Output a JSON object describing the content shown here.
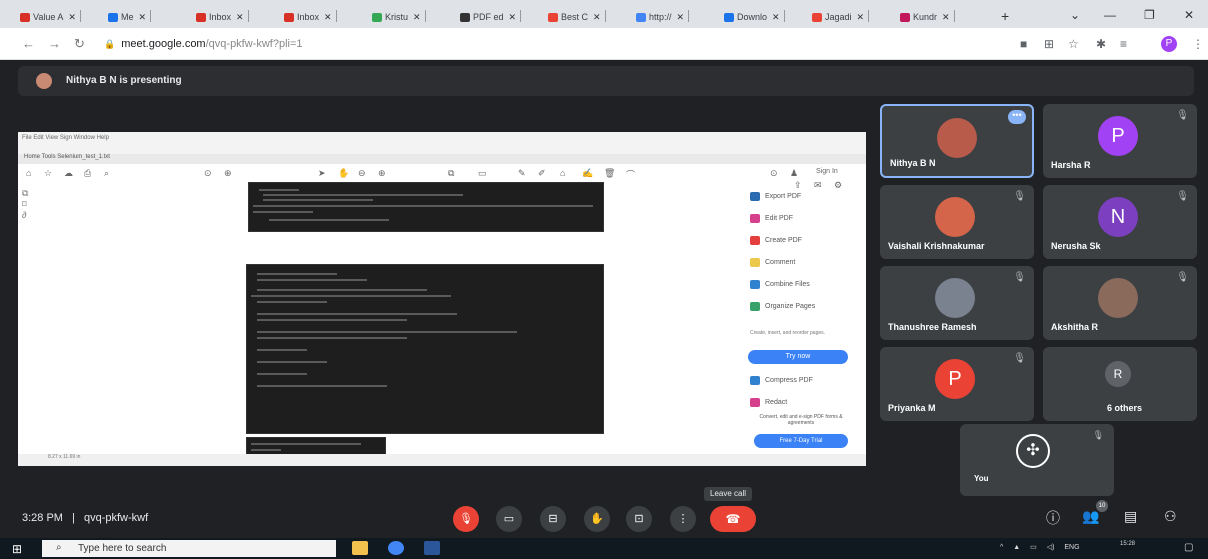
{
  "browser": {
    "tabs": [
      {
        "label": "Value A",
        "color": "#d93025"
      },
      {
        "label": "Me",
        "color": "#1a73e8"
      },
      {
        "label": "Inbox",
        "color": "#d93025"
      },
      {
        "label": "Inbox",
        "color": "#d93025"
      },
      {
        "label": "Kristu",
        "color": "#34a853"
      },
      {
        "label": "PDF ed",
        "color": "#333333"
      },
      {
        "label": "Best C",
        "color": "#ea4335"
      },
      {
        "label": "http://",
        "color": "#4285f4"
      },
      {
        "label": "Downlo",
        "color": "#1a73e8"
      },
      {
        "label": "Jagadi",
        "color": "#ea4335"
      },
      {
        "label": "Kundr",
        "color": "#c2185b"
      }
    ],
    "new_tab": "+",
    "url_host": "meet.google.com",
    "url_path": "/qvq-pkfw-kwf?pli=1",
    "profile_initial": "P"
  },
  "meet": {
    "presenting_text": "Nithya B N is presenting",
    "shared_screen": {
      "menu_text": "File  Edit  View  Sign  Window  Help",
      "tabs_text": "Home   Tools   Selenium_test_1.txt",
      "sign_in": "Sign In",
      "tools": [
        {
          "label": "Export PDF",
          "color": "#2b6cb0"
        },
        {
          "label": "Edit PDF",
          "color": "#d53f8c"
        },
        {
          "label": "Create PDF",
          "color": "#e53e3e"
        },
        {
          "label": "Comment",
          "color": "#ecc94b"
        },
        {
          "label": "Combine Files",
          "color": "#3182ce"
        },
        {
          "label": "Organize Pages",
          "color": "#38a169"
        }
      ],
      "promo_text": "Create, insert, and reorder pages.",
      "try_now": "Try now",
      "tools2": [
        {
          "label": "Compress PDF",
          "color": "#3182ce"
        },
        {
          "label": "Redact",
          "color": "#d53f8c"
        }
      ],
      "convert_text": "Convert, edit and e-sign PDF forms & agreements",
      "free_trial": "Free 7-Day Trial",
      "status_text": "8.27 x 11.69 in"
    },
    "participants": [
      {
        "name": "Nithya B N",
        "initial": "",
        "avatar_color": "#b85b4a",
        "active": true
      },
      {
        "name": "Harsha R",
        "initial": "P",
        "avatar_color": "#a142f4",
        "active": false
      },
      {
        "name": "Vaishali Krishnakumar",
        "initial": "",
        "avatar_color": "#d4644a",
        "active": false
      },
      {
        "name": "Nerusha Sk",
        "initial": "N",
        "avatar_color": "#7b3fbf",
        "active": false
      },
      {
        "name": "Thanushree Ramesh",
        "initial": "",
        "avatar_color": "#7a8290",
        "active": false
      },
      {
        "name": "Akshitha R",
        "initial": "",
        "avatar_color": "#8a6a5a",
        "active": false
      },
      {
        "name": "Priyanka M",
        "initial": "P",
        "avatar_color": "#ea4335",
        "active": false
      },
      {
        "name": "6 others",
        "initial": "R",
        "avatar_color": "#5f6368",
        "active": false
      }
    ],
    "self_label": "You",
    "time": "3:28 PM",
    "separator": "|",
    "meeting_code": "qvq-pkfw-kwf",
    "leave_call_tooltip": "Leave call",
    "participant_count": "10"
  },
  "taskbar": {
    "search_placeholder": "Type here to search",
    "tray_lang": "ENG",
    "tray_time": "15:28"
  }
}
